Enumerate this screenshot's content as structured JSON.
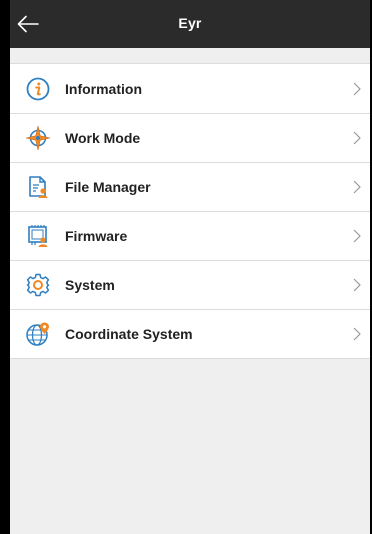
{
  "header": {
    "title": "Eyr",
    "back_icon": "arrow-left-icon"
  },
  "menu": {
    "items": [
      {
        "label": "Information",
        "icon": "info-icon"
      },
      {
        "label": "Work Mode",
        "icon": "compass-icon"
      },
      {
        "label": "File Manager",
        "icon": "file-manager-icon"
      },
      {
        "label": "Firmware",
        "icon": "firmware-icon"
      },
      {
        "label": "System",
        "icon": "gear-icon"
      },
      {
        "label": "Coordinate System",
        "icon": "globe-pin-icon"
      }
    ],
    "chevron_icon": "chevron-right-icon"
  },
  "colors": {
    "header_bg": "#2b2b2b",
    "page_bg": "#efeff0",
    "icon_blue": "#2f7fc1",
    "icon_orange": "#f08a24"
  }
}
